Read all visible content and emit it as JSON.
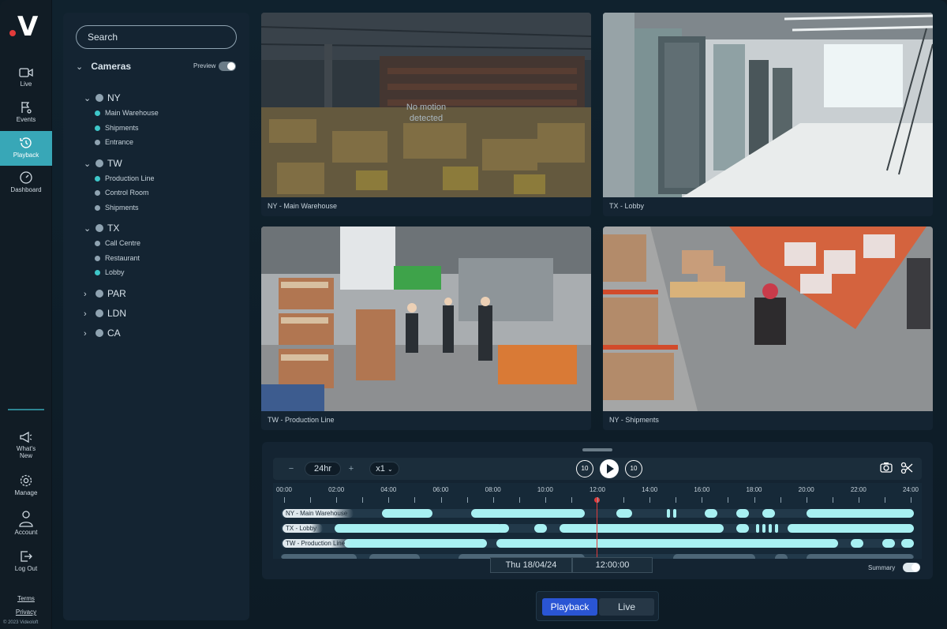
{
  "brand": {
    "mark": "V"
  },
  "nav": [
    {
      "label": "Live",
      "icon": "camera-icon"
    },
    {
      "label": "Events",
      "icon": "events-icon"
    },
    {
      "label": "Playback",
      "icon": "history-icon",
      "active": true
    },
    {
      "label": "Dashboard",
      "icon": "gauge-icon"
    }
  ],
  "nav_bottom": [
    {
      "label_line1": "What's",
      "label_line2": "New",
      "icon": "megaphone-icon"
    },
    {
      "label_line1": "Manage",
      "label_line2": "",
      "icon": "gear-icon"
    },
    {
      "label_line1": "Account",
      "label_line2": "",
      "icon": "user-icon"
    },
    {
      "label_line1": "Log Out",
      "label_line2": "",
      "icon": "logout-icon"
    }
  ],
  "footer": {
    "terms": "Terms",
    "privacy": "Privacy",
    "copyright": "© 2023 Videoloft"
  },
  "tree": {
    "search_placeholder": "Search",
    "title": "Cameras",
    "preview_label": "Preview",
    "sites": [
      {
        "name": "NY",
        "cameras": [
          {
            "name": "Main Warehouse",
            "status": "active"
          },
          {
            "name": "Shipments",
            "status": "active"
          },
          {
            "name": "Entrance",
            "status": "idle"
          }
        ]
      },
      {
        "name": "TW",
        "cameras": [
          {
            "name": "Production Line",
            "status": "active"
          },
          {
            "name": "Control Room",
            "status": "idle"
          },
          {
            "name": "Shipments",
            "status": "idle"
          }
        ]
      },
      {
        "name": "TX",
        "cameras": [
          {
            "name": "Call Centre",
            "status": "idle"
          },
          {
            "name": "Restaurant",
            "status": "idle"
          },
          {
            "name": "Lobby",
            "status": "active"
          }
        ]
      },
      {
        "name": "PAR",
        "cameras": []
      },
      {
        "name": "LDN",
        "cameras": []
      },
      {
        "name": "CA",
        "cameras": []
      }
    ]
  },
  "tiles": [
    {
      "caption": "NY - Main Warehouse",
      "overlay_line1": "No motion",
      "overlay_line2": "detected"
    },
    {
      "caption": "TX - Lobby"
    },
    {
      "caption": "TW - Production Line"
    },
    {
      "caption": "NY - Shipments"
    }
  ],
  "timeline": {
    "range": "24hr",
    "speed": "x1",
    "skip_back": "10",
    "skip_fwd": "10",
    "hours": [
      "00:00",
      "02:00",
      "04:00",
      "06:00",
      "08:00",
      "10:00",
      "12:00",
      "14:00",
      "16:00",
      "18:00",
      "20:00",
      "22:00",
      "24:00"
    ],
    "tracks": [
      {
        "label": "NY - Main Warehouse"
      },
      {
        "label": "TX - Lobby"
      },
      {
        "label": "TW - Production Line"
      }
    ],
    "date": "Thu 18/04/24",
    "time": "12:00:00",
    "summary_label": "Summary"
  },
  "modes": {
    "playback": "Playback",
    "live": "Live"
  },
  "colors": {
    "accent": "#38a7b7",
    "status_active": "#3ec7c9",
    "status_idle": "#8fa3b1",
    "playhead": "#e23b3b",
    "mode_active": "#2a55d4"
  }
}
